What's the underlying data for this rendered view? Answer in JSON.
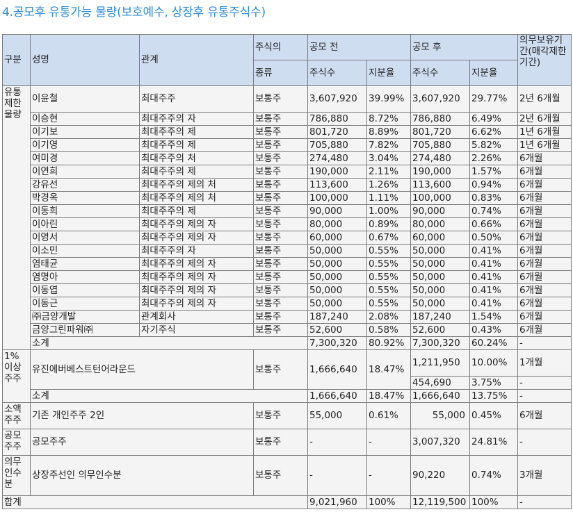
{
  "title": "4.공모후 유통가능 물량(보호예수, 상장후 유통주식수)",
  "headers": {
    "category": "구분",
    "name": "성명",
    "relation": "관계",
    "stock_type_top": "주식의",
    "stock_type_bottom": "종류",
    "before": "공모 전",
    "after": "공모 후",
    "shares": "주식수",
    "ratio": "지분율",
    "lockup": "의무보유기간(매각제한기간)"
  },
  "groups": {
    "restricted": "유통제한물량",
    "major": "1% 이상 주주",
    "minor": "소액주주",
    "public": "공모주주",
    "underwriter": "의무인수분",
    "total": "합계"
  },
  "restricted_rows": [
    {
      "name": "이윤철",
      "relation": "최대주주",
      "type": "보통주",
      "bs": "3,607,920",
      "br": "39.99%",
      "as": "3,607,920",
      "ar": "29.77%",
      "lock": "2년 6개월"
    },
    {
      "name": "이승현",
      "relation": "최대주주의 자",
      "type": "보통주",
      "bs": "786,880",
      "br": "8.72%",
      "as": "786,880",
      "ar": "6.49%",
      "lock": "2년 6개월"
    },
    {
      "name": "이기보",
      "relation": "최대주주의 제",
      "type": "보통주",
      "bs": "801,720",
      "br": "8.89%",
      "as": "801,720",
      "ar": "6.62%",
      "lock": "1년 6개월"
    },
    {
      "name": "이기영",
      "relation": "최대주주의 제",
      "type": "보통주",
      "bs": "705,880",
      "br": "7.82%",
      "as": "705,880",
      "ar": "5.82%",
      "lock": "1년 6개월"
    },
    {
      "name": "여미경",
      "relation": "최대주주의 처",
      "type": "보통주",
      "bs": "274,480",
      "br": "3.04%",
      "as": "274,480",
      "ar": "2.26%",
      "lock": "6개월"
    },
    {
      "name": "이연희",
      "relation": "최대주주의 제",
      "type": "보통주",
      "bs": "190,000",
      "br": "2.11%",
      "as": "190,000",
      "ar": "1.57%",
      "lock": "6개월"
    },
    {
      "name": "강유선",
      "relation": "최대주주의 제의 처",
      "type": "보통주",
      "bs": "113,600",
      "br": "1.26%",
      "as": "113,600",
      "ar": "0.94%",
      "lock": "6개월"
    },
    {
      "name": "박경옥",
      "relation": "최대주주의 제의 처",
      "type": "보통주",
      "bs": "100,000",
      "br": "1.11%",
      "as": "100,000",
      "ar": "0.83%",
      "lock": "6개월"
    },
    {
      "name": "이동희",
      "relation": "최대주주의 제",
      "type": "보통주",
      "bs": "90,000",
      "br": "1.00%",
      "as": "90,000",
      "ar": "0.74%",
      "lock": "6개월"
    },
    {
      "name": "이아린",
      "relation": "최대주주의 제의 자",
      "type": "보통주",
      "bs": "80,000",
      "br": "0.89%",
      "as": "80,000",
      "ar": "0.66%",
      "lock": "6개월"
    },
    {
      "name": "이영서",
      "relation": "최대주주의 제의 자",
      "type": "보통주",
      "bs": "60,000",
      "br": "0.67%",
      "as": "60,000",
      "ar": "0.50%",
      "lock": "6개월"
    },
    {
      "name": "이소민",
      "relation": "최대주주의 자",
      "type": "보통주",
      "bs": "50,000",
      "br": "0.55%",
      "as": "50,000",
      "ar": "0.41%",
      "lock": "6개월"
    },
    {
      "name": "염태균",
      "relation": "최대주주의 제의 자",
      "type": "보통주",
      "bs": "50,000",
      "br": "0.55%",
      "as": "50,000",
      "ar": "0.41%",
      "lock": "6개월"
    },
    {
      "name": "염명아",
      "relation": "최대주주의 제의 자",
      "type": "보통주",
      "bs": "50,000",
      "br": "0.55%",
      "as": "50,000",
      "ar": "0.41%",
      "lock": "6개월"
    },
    {
      "name": "이동엽",
      "relation": "최대주주의 제의 자",
      "type": "보통주",
      "bs": "50,000",
      "br": "0.55%",
      "as": "50,000",
      "ar": "0.41%",
      "lock": "6개월"
    },
    {
      "name": "이동근",
      "relation": "최대주주의 제의 자",
      "type": "보통주",
      "bs": "50,000",
      "br": "0.55%",
      "as": "50,000",
      "ar": "0.41%",
      "lock": "6개월"
    },
    {
      "name": "㈜금양개발",
      "relation": "관계회사",
      "type": "보통주",
      "bs": "187,240",
      "br": "2.08%",
      "as": "187,240",
      "ar": "1.54%",
      "lock": "6개월"
    },
    {
      "name": "금양그린파워㈜",
      "relation": "자기주식",
      "type": "보통주",
      "bs": "52,600",
      "br": "0.58%",
      "as": "52,600",
      "ar": "0.43%",
      "lock": "6개월"
    }
  ],
  "restricted_subtotal": {
    "label": "소계",
    "bs": "7,300,320",
    "br": "80.92%",
    "as": "7,300,320",
    "ar": "60.24%",
    "lock": "-"
  },
  "major_row": {
    "name": "유진에버베스트턴어라운드",
    "type": "보통주",
    "bs": "1,666,640",
    "br": "18.47%",
    "as1": "1,211,950",
    "ar1": "10.00%",
    "lock1": "1개월",
    "as2": "454,690",
    "ar2": "3.75%",
    "lock2": "-"
  },
  "major_subtotal": {
    "label": "소계",
    "bs": "1,666,640",
    "br": "18.47%",
    "as": "1,666,640",
    "ar": "13.75%",
    "lock": "-"
  },
  "minor_row": {
    "name": "기존 개인주주 2인",
    "type": "보통주",
    "bs": "55,000",
    "br": "0.61%",
    "as": "55,000",
    "ar": "0.45%",
    "lock": "6개월"
  },
  "public_row": {
    "name": "공모주주",
    "type": "보통주",
    "bs": "-",
    "br": "-",
    "as": "3,007,320",
    "ar": "24.81%",
    "lock": "-"
  },
  "underwriter_row": {
    "name": "상장주선인 의무인수분",
    "type": "보통주",
    "bs": "-",
    "br": "-",
    "as": "90,220",
    "ar": "0.74%",
    "lock": "3개월"
  },
  "total_row": {
    "bs": "9,021,960",
    "br": "100%",
    "as": "12,119,500",
    "ar": "100%",
    "lock": "-"
  }
}
